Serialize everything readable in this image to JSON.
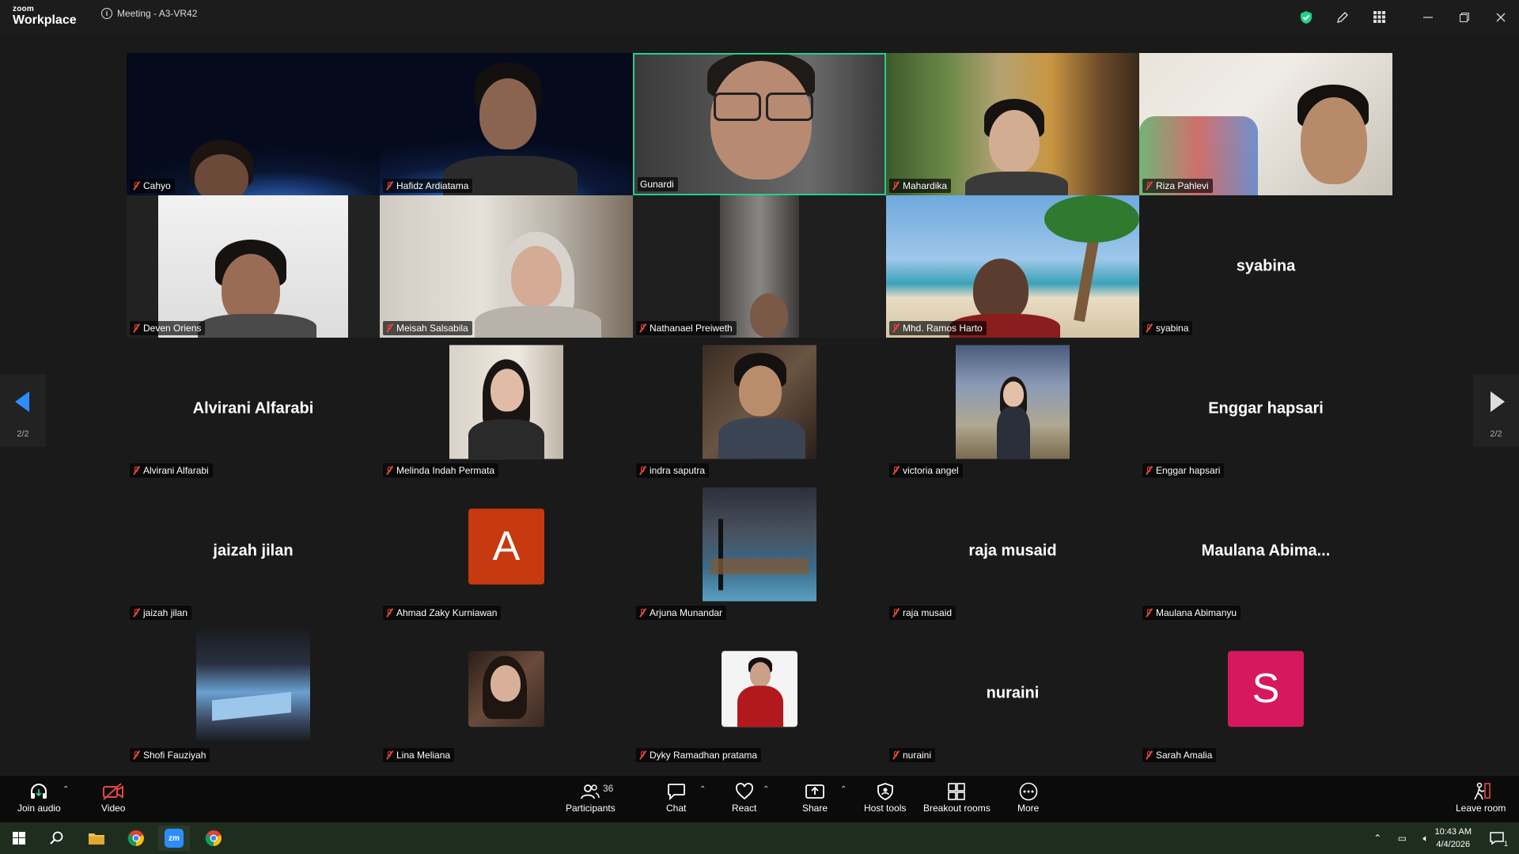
{
  "app": {
    "logo_top": "zoom",
    "logo_bottom": "Workplace",
    "meeting_title": "Meeting - A3-VR42"
  },
  "window_icons": [
    "shield-check-icon",
    "pencil-icon",
    "apps-grid-icon",
    "minimize-icon",
    "restore-icon",
    "close-icon"
  ],
  "colors": {
    "active_speaker": "#23d18b",
    "muted": "#e5483b",
    "accent": "#2d8cff",
    "avatar_a": "#c7390e",
    "avatar_s": "#d6195e"
  },
  "pager": {
    "label": "2/2"
  },
  "participants": [
    {
      "name": "Cahyo",
      "kind": "video"
    },
    {
      "name": "Hafidz Ardiatama",
      "kind": "video"
    },
    {
      "name": "Gunardi",
      "kind": "video",
      "active": true
    },
    {
      "name": "Mahardika",
      "kind": "video"
    },
    {
      "name": "Riza Pahlevi",
      "kind": "video"
    },
    {
      "name": "Deven Oriens",
      "kind": "video"
    },
    {
      "name": "Meisah Salsabila",
      "kind": "video"
    },
    {
      "name": "Nathanael Preiweth",
      "kind": "video"
    },
    {
      "name": "Mhd. Ramos Harto",
      "kind": "video"
    },
    {
      "name": "syabina",
      "kind": "text",
      "display": "syabina"
    },
    {
      "name": "Alvirani Alfarabi",
      "kind": "text",
      "display": "Alvirani Alfarabi"
    },
    {
      "name": "Melinda Indah Permata",
      "kind": "photo"
    },
    {
      "name": "indra saputra",
      "kind": "photo"
    },
    {
      "name": "victoria angel",
      "kind": "photo"
    },
    {
      "name": "Enggar hapsari",
      "kind": "text",
      "display": "Enggar hapsari"
    },
    {
      "name": "jaizah jilan",
      "kind": "text",
      "display": "jaizah jilan"
    },
    {
      "name": "Ahmad Zaky Kurniawan",
      "kind": "letter",
      "letter": "A"
    },
    {
      "name": "Arjuna Munandar",
      "kind": "photo"
    },
    {
      "name": "raja musaid",
      "kind": "text",
      "display": "raja musaid"
    },
    {
      "name": "Maulana Abimanyu",
      "kind": "text",
      "display": "Maulana  Abima..."
    },
    {
      "name": "Shofi Fauziyah",
      "kind": "photo"
    },
    {
      "name": "Lina Meliana",
      "kind": "photo-small"
    },
    {
      "name": "Dyky Ramadhan pratama",
      "kind": "photo-small"
    },
    {
      "name": "nuraini",
      "kind": "text",
      "display": "nuraini"
    },
    {
      "name": "Sarah Amalia",
      "kind": "letter",
      "letter": "S"
    }
  ],
  "toolbar": {
    "join_audio": "Join audio",
    "video": "Video",
    "participants": "Participants",
    "participants_count": "36",
    "chat": "Chat",
    "react": "React",
    "share": "Share",
    "host_tools": "Host tools",
    "breakout_rooms": "Breakout rooms",
    "more": "More",
    "leave_room": "Leave room"
  },
  "taskbar": {
    "time": "10:43 AM",
    "date": "4/4/2026",
    "notification_count": "1"
  }
}
